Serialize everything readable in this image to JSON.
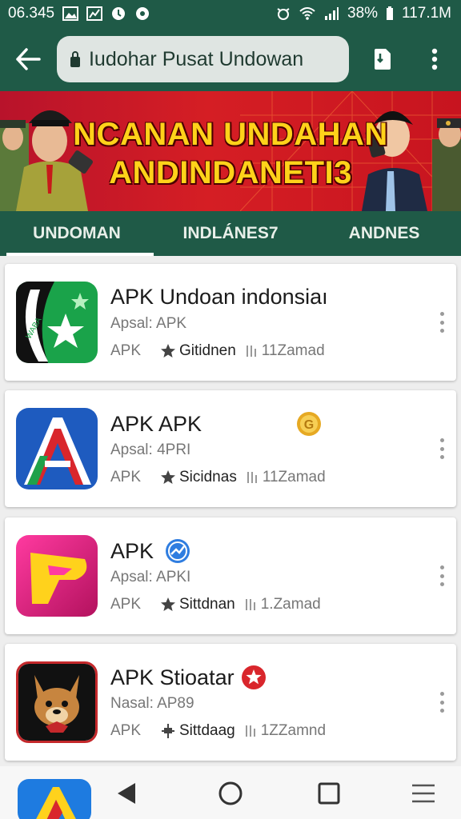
{
  "status_bar": {
    "time": "06.345",
    "battery": "38%",
    "speed": "117.1M"
  },
  "app_bar": {
    "url_text": "Iudohar Pusat Undowan"
  },
  "banner": {
    "line1": "NCANAN UNDAHAN",
    "line2": "ANDINDANETI3"
  },
  "tabs": [
    {
      "label": "UNDOMAN",
      "active": true
    },
    {
      "label": "INDLÁNES7",
      "active": false
    },
    {
      "label": "ANDNES",
      "active": false
    }
  ],
  "apps": [
    {
      "title": "APK Undoan indonsiaı",
      "subtitle": "Apsal: APK",
      "tag": "APK",
      "rating_label": "Gitidnen",
      "size": "11Zamad",
      "icon": "green-star-flag-icon",
      "badge": ""
    },
    {
      "title": "APK APK",
      "subtitle": "Apsal: 4PRI",
      "tag": "APK",
      "rating_label": "Sicidnas",
      "size": "11Zamad",
      "icon": "blue-red-a-icon",
      "badge": "gold-coin-badge-icon"
    },
    {
      "title": "APK",
      "subtitle": "Apsal: APKI",
      "tag": "APK",
      "rating_label": "Sittdnan",
      "size": "1.Zamad",
      "icon": "yellow-p-play-icon",
      "badge": "blue-verified-badge-icon"
    },
    {
      "title": "APK Stioatar",
      "subtitle": "Nasal: AP89",
      "tag": "APK",
      "rating_label": "Sittdaag",
      "size": "1ZZamnd",
      "icon": "fox-mascot-icon",
      "badge": "red-star-badge-icon"
    }
  ],
  "colors": {
    "primary": "#1f5a47",
    "banner_red": "#d51e24",
    "banner_text": "#ffd21a"
  }
}
